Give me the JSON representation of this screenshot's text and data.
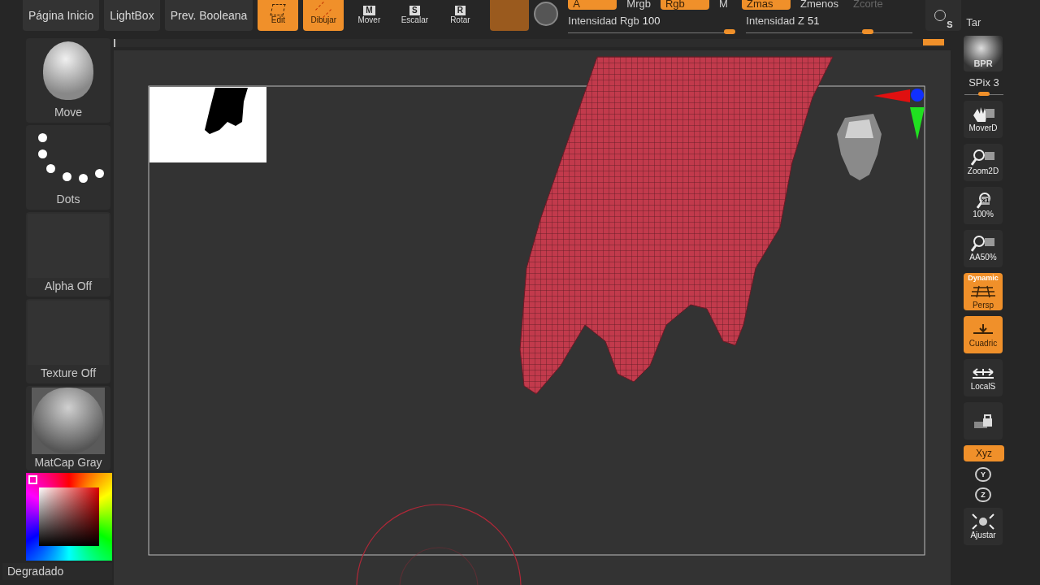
{
  "top_menu": [
    {
      "label": "Página Inicio"
    },
    {
      "label": "LightBox"
    },
    {
      "label": "Prev. Booleana"
    }
  ],
  "tools": [
    {
      "label": "Edit",
      "selected": true,
      "kind": "edit"
    },
    {
      "label": "Dibujar",
      "selected": true,
      "kind": "draw"
    },
    {
      "label": "Mover",
      "badge": "M",
      "selected": false,
      "kind": "letter"
    },
    {
      "label": "Escalar",
      "badge": "S",
      "selected": false,
      "kind": "letter"
    },
    {
      "label": "Rotar",
      "badge": "R",
      "selected": false,
      "kind": "letter"
    }
  ],
  "toggles_top": [
    {
      "label": "A",
      "on": true
    },
    {
      "label": "Mrgb",
      "on": false
    },
    {
      "label": "Rgb",
      "on": true
    },
    {
      "label": "M",
      "on": false
    },
    {
      "label": "Zmas",
      "on": true
    },
    {
      "label": "Zmenos",
      "on": false
    },
    {
      "label": "Zcorte",
      "on": false,
      "disabled": true
    }
  ],
  "sliders": [
    {
      "label": "Intensidad Rgb",
      "value": "100",
      "level": 0.97
    },
    {
      "label": "Intensidad Z",
      "value": "51",
      "level": 0.73
    }
  ],
  "corner": {
    "badge": "S",
    "label": "Tar"
  },
  "left_shelf": [
    {
      "kind": "brush",
      "label": "Move"
    },
    {
      "kind": "stroke",
      "label": "Dots"
    },
    {
      "kind": "empty",
      "label": "Alpha Off"
    },
    {
      "kind": "empty",
      "label": "Texture Off"
    },
    {
      "kind": "material",
      "label": "MatCap Gray"
    }
  ],
  "color": {
    "label": "Degradado"
  },
  "right_shelf": [
    {
      "kind": "bpr",
      "label": "BPR"
    },
    {
      "kind": "slider",
      "label": "SPix 3",
      "level": 0.5
    },
    {
      "kind": "button",
      "label": "MoverD",
      "selected": false
    },
    {
      "kind": "button",
      "label": "Zoom2D",
      "selected": false
    },
    {
      "kind": "button",
      "label": "100%",
      "badge": "x1",
      "selected": false
    },
    {
      "kind": "button",
      "label": "AA50%",
      "selected": false
    },
    {
      "kind": "button",
      "label": "Persp",
      "top": "Dynamic",
      "selected": true
    },
    {
      "kind": "button",
      "label": "Cuadric",
      "selected": true
    },
    {
      "kind": "button",
      "label": "LocalS",
      "selected": false
    },
    {
      "kind": "button",
      "selected": false
    },
    {
      "kind": "small",
      "label": "Xyz",
      "selected": true
    },
    {
      "kind": "rot",
      "badge": "Y"
    },
    {
      "kind": "rot",
      "badge": "Z"
    },
    {
      "kind": "button",
      "label": "Ajustar",
      "selected": false
    }
  ]
}
